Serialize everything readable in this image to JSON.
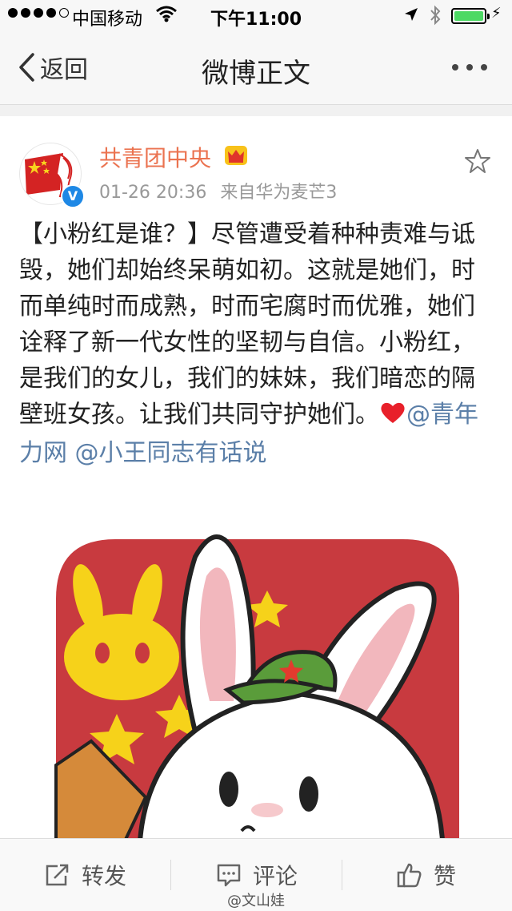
{
  "status_bar": {
    "carrier": "中国移动",
    "time": "下午11:00",
    "battery_level": 1.0
  },
  "nav": {
    "back_label": "返回",
    "title": "微博正文"
  },
  "post": {
    "author": "共青团中央",
    "timestamp": "01-26 20:36",
    "source": "来自华为麦芒3",
    "text": "【小粉红是谁？】尽管遭受着种种责难与诋毁，她们却始终呆萌如初。这就是她们，时而单纯时而成熟，时而宅腐时而优雅，她们诠释了新一代女性的坚韧与自信。小粉红，是我们的女儿，我们的妹妹，我们暗恋的隔壁班女孩。让我们共同守护她们。",
    "mentions": [
      "@青年力网",
      "@小王同志有话说"
    ],
    "verified_badge": "V"
  },
  "toolbar": {
    "repost_label": "转发",
    "comment_label": "评论",
    "like_label": "赞"
  },
  "watermark": "@文山娃",
  "colors": {
    "author": "#eb7350",
    "mention": "#5b7fa8",
    "verified": "#1e88e5",
    "image_red": "#c83a3f",
    "star_yellow": "#f6d21a"
  }
}
